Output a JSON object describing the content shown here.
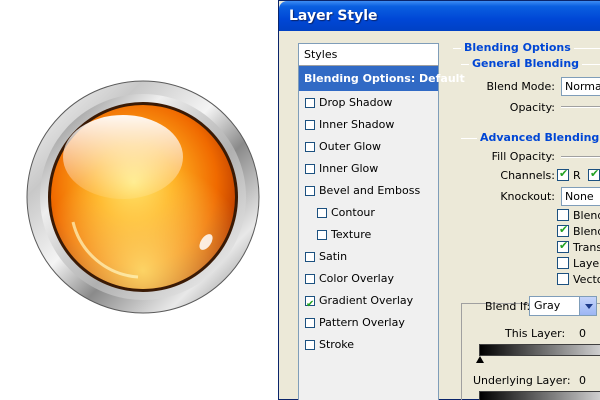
{
  "dialog": {
    "title": "Layer Style"
  },
  "styles_list": {
    "header": "Styles",
    "selected": "Blending Options: Default",
    "items": [
      {
        "label": "Drop Shadow",
        "checked": false,
        "indent": 0
      },
      {
        "label": "Inner Shadow",
        "checked": false,
        "indent": 0
      },
      {
        "label": "Outer Glow",
        "checked": false,
        "indent": 0
      },
      {
        "label": "Inner Glow",
        "checked": false,
        "indent": 0
      },
      {
        "label": "Bevel and Emboss",
        "checked": false,
        "indent": 0
      },
      {
        "label": "Contour",
        "checked": false,
        "indent": 1
      },
      {
        "label": "Texture",
        "checked": false,
        "indent": 1
      },
      {
        "label": "Satin",
        "checked": false,
        "indent": 0
      },
      {
        "label": "Color Overlay",
        "checked": false,
        "indent": 0
      },
      {
        "label": "Gradient Overlay",
        "checked": true,
        "indent": 0
      },
      {
        "label": "Pattern Overlay",
        "checked": false,
        "indent": 0
      },
      {
        "label": "Stroke",
        "checked": false,
        "indent": 0
      }
    ]
  },
  "blending": {
    "section_title": "Blending Options",
    "general_title": "General Blending",
    "blend_mode_label": "Blend Mode:",
    "blend_mode_value": "Normal",
    "opacity_label": "Opacity:",
    "advanced_title": "Advanced Blending",
    "fill_opacity_label": "Fill Opacity:",
    "channels_label": "Channels:",
    "channel_r": "R",
    "knockout_label": "Knockout:",
    "knockout_value": "None",
    "options": [
      {
        "label": "Blend",
        "checked": false
      },
      {
        "label": "Blend",
        "checked": true
      },
      {
        "label": "Transp",
        "checked": true
      },
      {
        "label": "Layer",
        "checked": false
      },
      {
        "label": "Vector",
        "checked": false
      }
    ],
    "blend_if_label": "Blend If:",
    "blend_if_value": "Gray",
    "this_layer_label": "This Layer:",
    "this_layer_value": "0",
    "underlying_label": "Underlying Layer:",
    "underlying_value": "0"
  },
  "colors": {
    "title_bar": "#0047d6",
    "selection": "#316ac5",
    "section_title": "#0046d5",
    "check": "#21a121",
    "orb_outer": "#e05a00",
    "orb_inner": "#ffd84a"
  }
}
